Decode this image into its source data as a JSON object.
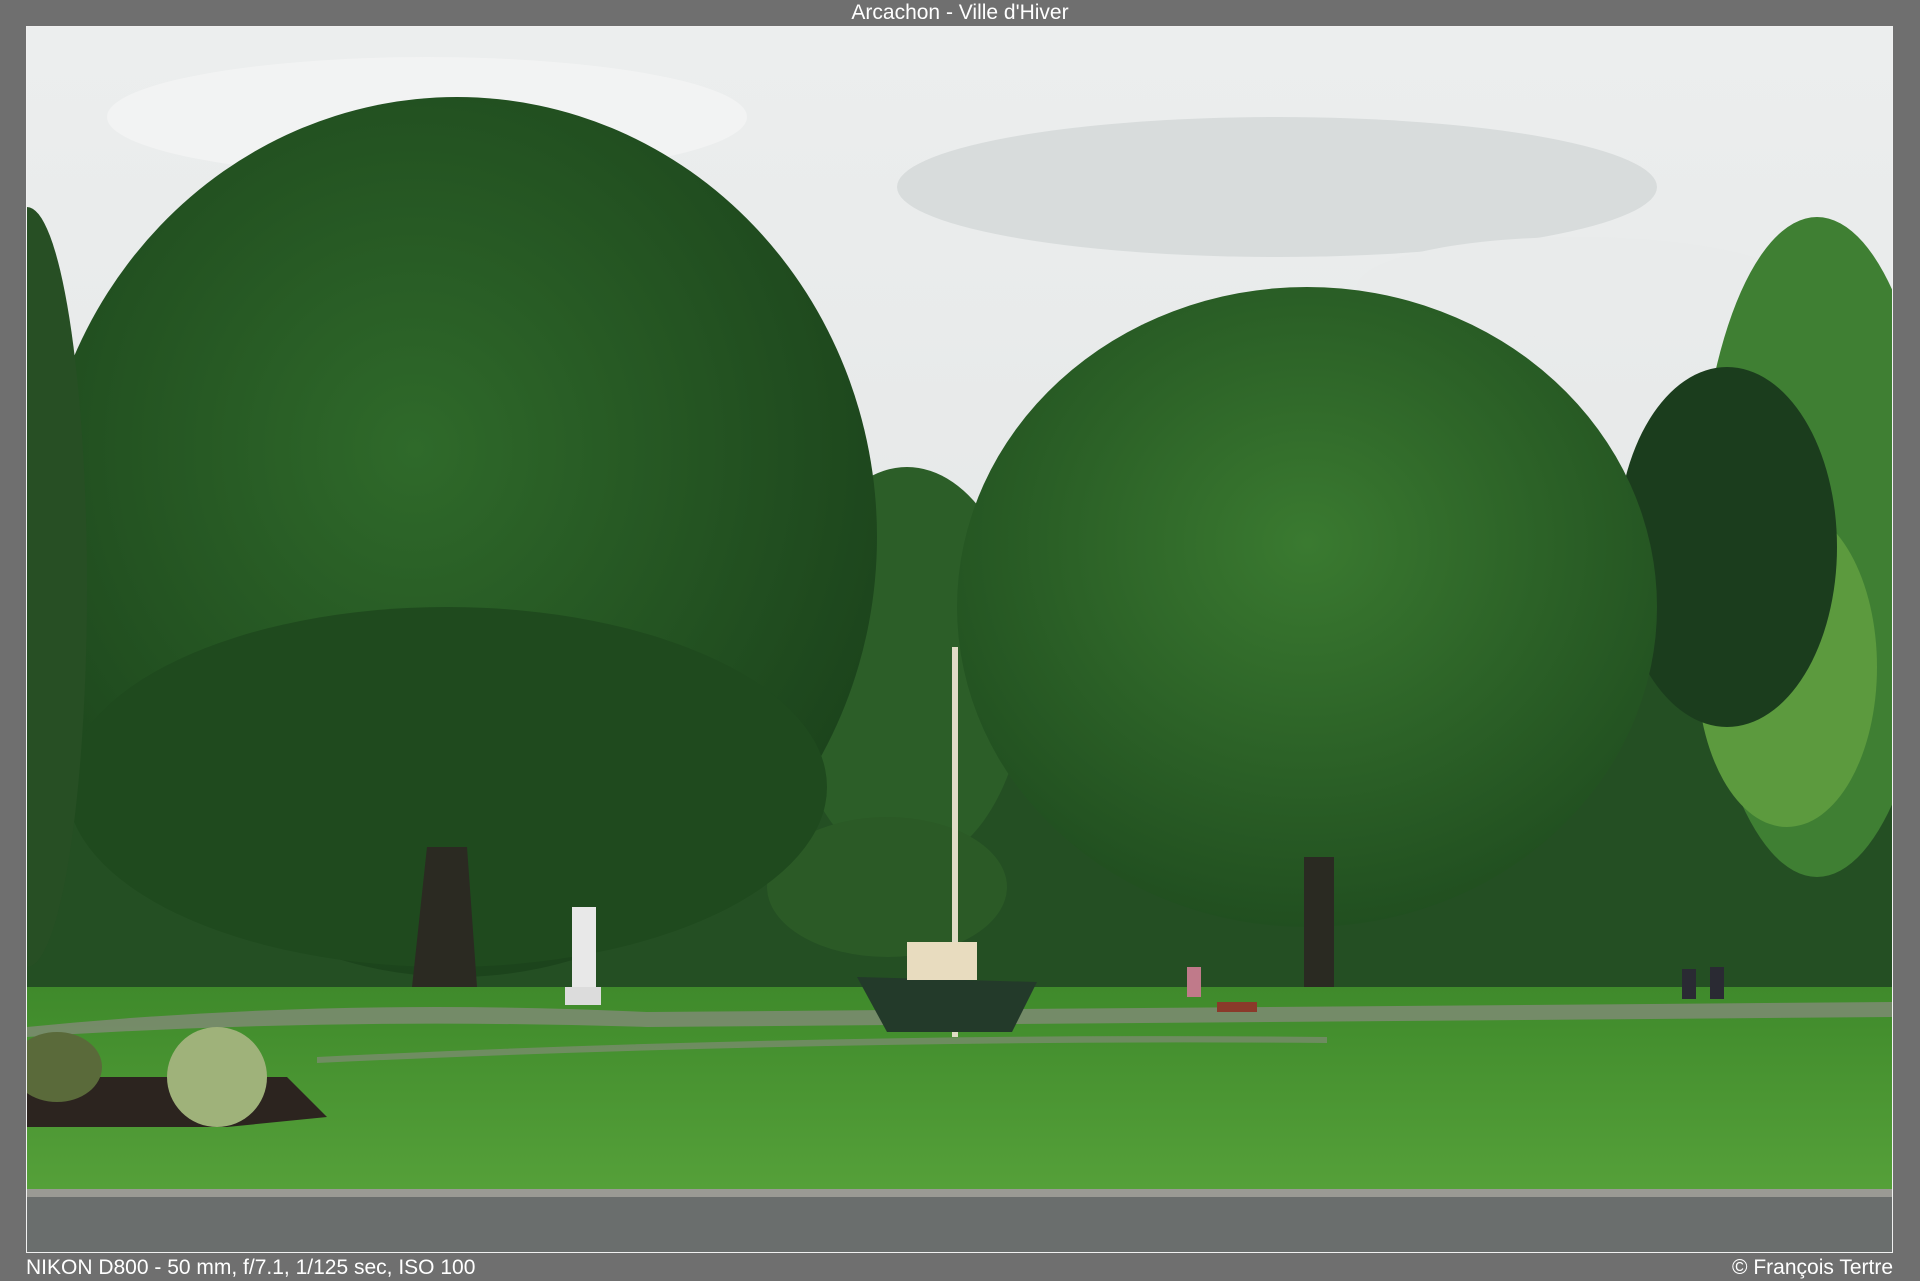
{
  "header": {
    "title": "Arcachon - Ville d'Hiver"
  },
  "footer": {
    "camera_info": "NIKON D800 - 50 mm, f/7.1, 1/125 sec, ISO 100",
    "copyright": "© François Tertre"
  },
  "colors": {
    "frame_background": "#6f6f6f",
    "sky": "#e4e6e6",
    "foliage_dark": "#1f4d1f",
    "foliage_mid": "#2f6a2a",
    "foliage_light": "#5f9a3e",
    "lawn": "#4f9a34",
    "road": "#6b6f6e",
    "text": "#ffffff"
  },
  "scene": {
    "subject": "park with large trees, lawn, boat and flagpole"
  }
}
